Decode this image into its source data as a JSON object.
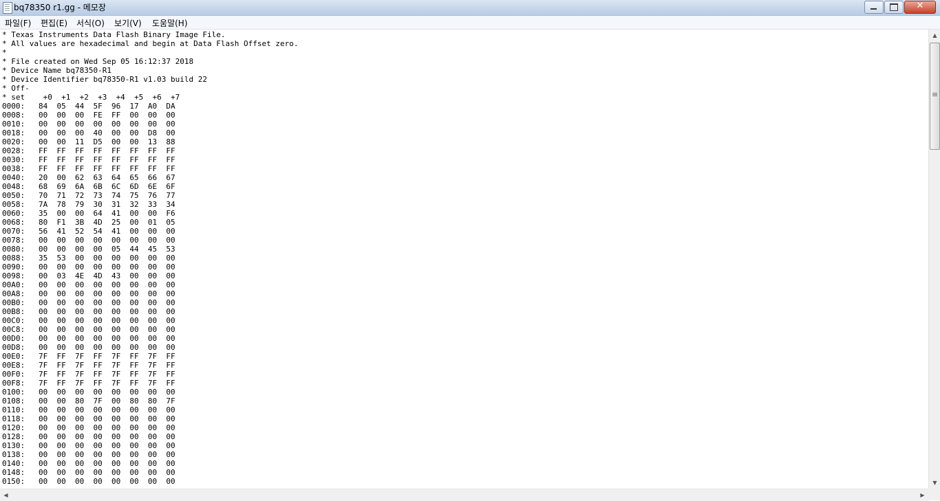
{
  "window": {
    "title": "bq78350 r1.gg - 메모장"
  },
  "menu": [
    "파일(F)",
    "편집(E)",
    "서식(O)",
    "보기(V)",
    "도움말(H)"
  ],
  "content": {
    "lines": [
      "* Texas Instruments Data Flash Binary Image File.",
      "* All values are hexadecimal and begin at Data Flash Offset zero.",
      "*",
      "* File created on Wed Sep 05 16:12:37 2018",
      "* Device Name bq78350-R1",
      "* Device Identifier bq78350-R1 v1.03 build 22",
      "* Off-",
      "* set    +0  +1  +2  +3  +4  +5  +6  +7",
      "0000:   84  05  44  5F  96  17  A0  DA",
      "0008:   00  00  00  FE  FF  00  00  00",
      "0010:   00  00  00  00  00  00  00  00",
      "0018:   00  00  00  40  00  00  D8  00",
      "0020:   00  00  11  D5  00  00  13  88",
      "0028:   FF  FF  FF  FF  FF  FF  FF  FF",
      "0030:   FF  FF  FF  FF  FF  FF  FF  FF",
      "0038:   FF  FF  FF  FF  FF  FF  FF  FF",
      "0040:   20  00  62  63  64  65  66  67",
      "0048:   68  69  6A  6B  6C  6D  6E  6F",
      "0050:   70  71  72  73  74  75  76  77",
      "0058:   7A  78  79  30  31  32  33  34",
      "0060:   35  00  00  64  41  00  00  F6",
      "0068:   80  F1  3B  4D  25  00  01  05",
      "0070:   56  41  52  54  41  00  00  00",
      "0078:   00  00  00  00  00  00  00  00",
      "0080:   00  00  00  00  05  44  45  53",
      "0088:   35  53  00  00  00  00  00  00",
      "0090:   00  00  00  00  00  00  00  00",
      "0098:   00  03  4E  4D  43  00  00  00",
      "00A0:   00  00  00  00  00  00  00  00",
      "00A8:   00  00  00  00  00  00  00  00",
      "00B0:   00  00  00  00  00  00  00  00",
      "00B8:   00  00  00  00  00  00  00  00",
      "00C0:   00  00  00  00  00  00  00  00",
      "00C8:   00  00  00  00  00  00  00  00",
      "00D0:   00  00  00  00  00  00  00  00",
      "00D8:   00  00  00  00  00  00  00  00",
      "00E0:   7F  FF  7F  FF  7F  FF  7F  FF",
      "00E8:   7F  FF  7F  FF  7F  FF  7F  FF",
      "00F0:   7F  FF  7F  FF  7F  FF  7F  FF",
      "00F8:   7F  FF  7F  FF  7F  FF  7F  FF",
      "0100:   00  00  00  00  00  00  00  00",
      "0108:   00  00  80  7F  00  80  80  7F",
      "0110:   00  00  00  00  00  00  00  00",
      "0118:   00  00  00  00  00  00  00  00",
      "0120:   00  00  00  00  00  00  00  00",
      "0128:   00  00  00  00  00  00  00  00",
      "0130:   00  00  00  00  00  00  00  00",
      "0138:   00  00  00  00  00  00  00  00",
      "0140:   00  00  00  00  00  00  00  00",
      "0148:   00  00  00  00  00  00  00  00",
      "0150:   00  00  00  00  00  00  00  00"
    ]
  },
  "icons": {
    "app": "notepad-icon",
    "minimize": "minimize-icon",
    "maximize": "maximize-icon",
    "close": "close-icon",
    "scroll_up": "arrow-up-icon",
    "scroll_down": "arrow-down-icon",
    "scroll_left": "arrow-left-icon",
    "scroll_right": "arrow-right-icon"
  },
  "colors": {
    "close_button": "#c7432b",
    "titlebar": "#c9d9ec",
    "text": "#000000"
  }
}
